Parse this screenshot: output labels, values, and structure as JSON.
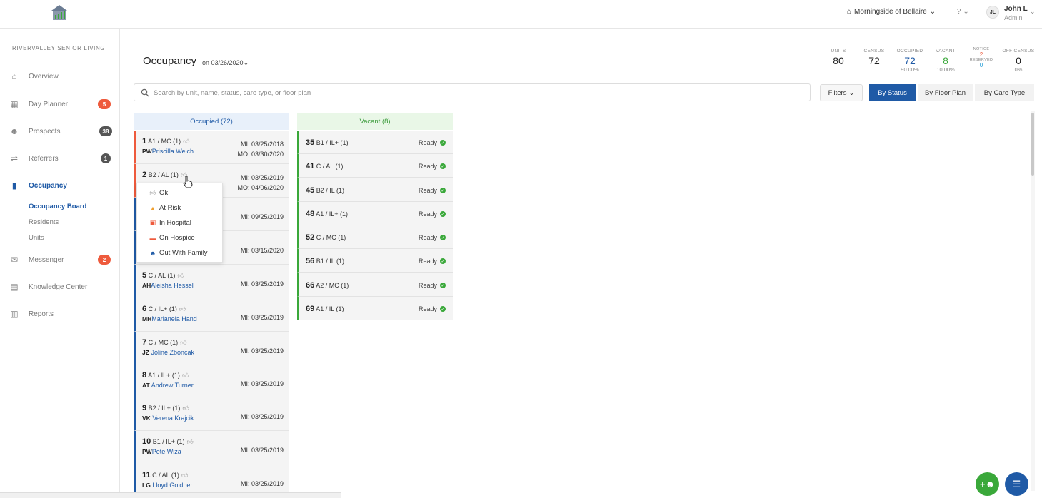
{
  "topbar": {
    "community": "Morningside of Bellaire",
    "help_symbol": "?",
    "user_initials": "JL",
    "user_name": "John L",
    "user_role": "Admin"
  },
  "sidebar": {
    "org": "RIVERVALLEY SENIOR LIVING",
    "items": [
      {
        "label": "Overview",
        "icon": "home-icon"
      },
      {
        "label": "Day Planner",
        "icon": "calendar-icon",
        "badge": "5"
      },
      {
        "label": "Prospects",
        "icon": "users-icon",
        "badge": "38"
      },
      {
        "label": "Referrers",
        "icon": "handshake-icon",
        "badge": "1"
      },
      {
        "label": "Occupancy",
        "icon": "door-icon"
      },
      {
        "label": "Messenger",
        "icon": "chat-icon",
        "badge": "2"
      },
      {
        "label": "Knowledge Center",
        "icon": "book-icon"
      },
      {
        "label": "Reports",
        "icon": "chart-icon"
      }
    ],
    "sub_items": [
      "Occupancy Board",
      "Residents",
      "Units"
    ]
  },
  "header": {
    "title": "Occupancy",
    "date": "on 03/26/2020"
  },
  "stats": {
    "units": {
      "label": "UNITS",
      "value": "80"
    },
    "census": {
      "label": "CENSUS",
      "value": "72"
    },
    "occupied": {
      "label": "OCCUPIED",
      "value": "72",
      "pct": "90.00%"
    },
    "vacant": {
      "label": "VACANT",
      "value": "8",
      "pct": "10.00%"
    },
    "notice": {
      "label": "NOTICE",
      "value": "2"
    },
    "reserved": {
      "label": "RESERVED",
      "value": "0"
    },
    "off_census": {
      "label": "OFF CENSUS",
      "value": "0",
      "pct": "0%"
    }
  },
  "search": {
    "placeholder": "Search by unit, name, status, care type, or floor plan"
  },
  "toolbar": {
    "filters": "Filters",
    "by_status": "By Status",
    "by_floor_plan": "By Floor Plan",
    "by_care_type": "By Care Type"
  },
  "columns": {
    "occupied_title": "Occupied (72)",
    "vacant_title": "Vacant (8)"
  },
  "occupied": [
    {
      "num": "1",
      "type": "A1 / MC (1)",
      "ini": "PW",
      "name": "Priscilla Welch",
      "mi": "MI: 03/25/2018",
      "mo": "MO: 03/30/2020"
    },
    {
      "num": "2",
      "type": "B2 / AL (1)",
      "ini": "",
      "name": "",
      "mi": "MI: 03/25/2019",
      "mo": "MO: 04/06/2020"
    },
    {
      "num": "",
      "type": "",
      "ini": "",
      "name": "",
      "mi": "MI: 09/25/2019",
      "mo": ""
    },
    {
      "num": "",
      "type": "",
      "ini": "",
      "name": "",
      "mi": "MI: 03/15/2020",
      "mo": ""
    },
    {
      "num": "5",
      "type": "C / AL (1)",
      "ini": "AH",
      "name": "Aleisha Hessel",
      "mi": "MI: 03/25/2019",
      "mo": ""
    },
    {
      "num": "6",
      "type": "C / IL+ (1)",
      "ini": "MH",
      "name": "Marianela Hand",
      "mi": "MI: 03/25/2019",
      "mo": ""
    },
    {
      "num": "7",
      "type": "C / MC (1)",
      "ini": "JZ",
      "name": "Joline Zboncak",
      "mi": "MI: 03/25/2019",
      "mo": ""
    },
    {
      "num": "8",
      "type": "A1 / IL+ (1)",
      "ini": "AT",
      "name": "Andrew Turner",
      "mi": "MI: 03/25/2019",
      "mo": ""
    },
    {
      "num": "9",
      "type": "B2 / IL+ (1)",
      "ini": "VK",
      "name": "Verena Krajcik",
      "mi": "MI: 03/25/2019",
      "mo": ""
    },
    {
      "num": "10",
      "type": "B1 / IL+ (1)",
      "ini": "PW",
      "name": "Pete Wiza",
      "mi": "MI: 03/25/2019",
      "mo": ""
    },
    {
      "num": "11",
      "type": "C / AL (1)",
      "ini": "LG",
      "name": "Lloyd Goldner",
      "mi": "MI: 03/25/2019",
      "mo": ""
    }
  ],
  "vacant": [
    {
      "num": "35",
      "type": "B1 / IL+ (1)",
      "status": "Ready"
    },
    {
      "num": "41",
      "type": "C / AL (1)",
      "status": "Ready"
    },
    {
      "num": "45",
      "type": "B2 / IL (1)",
      "status": "Ready"
    },
    {
      "num": "48",
      "type": "A1 / IL+ (1)",
      "status": "Ready"
    },
    {
      "num": "52",
      "type": "C / MC (1)",
      "status": "Ready"
    },
    {
      "num": "56",
      "type": "B1 / IL (1)",
      "status": "Ready"
    },
    {
      "num": "66",
      "type": "A2 / MC (1)",
      "status": "Ready"
    },
    {
      "num": "69",
      "type": "A1 / IL (1)",
      "status": "Ready"
    }
  ],
  "dropdown": [
    {
      "label": "Ok",
      "icon": "thumbs-up-icon"
    },
    {
      "label": "At Risk",
      "icon": "warning-icon"
    },
    {
      "label": "In Hospital",
      "icon": "hospital-icon"
    },
    {
      "label": "On Hospice",
      "icon": "bed-icon"
    },
    {
      "label": "Out With Family",
      "icon": "family-icon"
    }
  ],
  "colors": {
    "primary": "#1f5aa6",
    "success": "#3aa83a",
    "danger": "#ee5a3c"
  }
}
